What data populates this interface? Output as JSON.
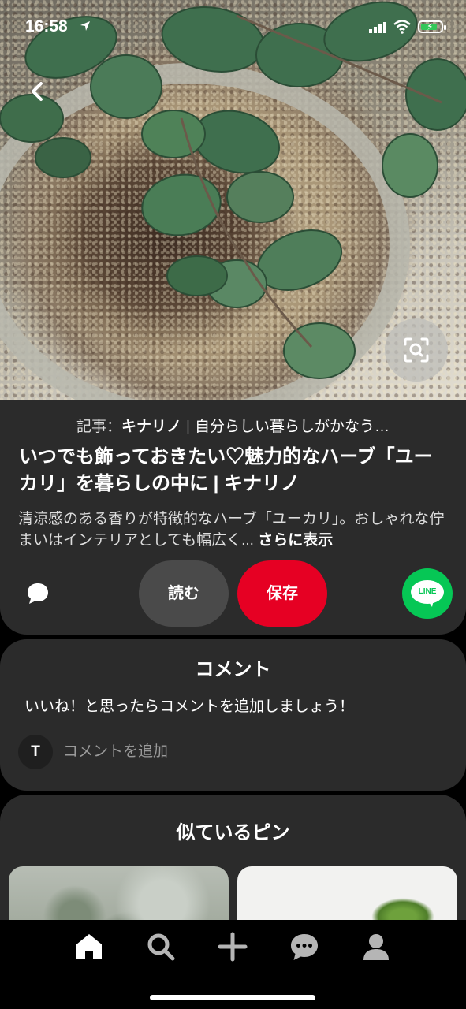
{
  "status_bar": {
    "time": "16:58"
  },
  "pin": {
    "source_prefix": "記事：",
    "source_brand": "キナリノ",
    "source_tagline": "自分らしい暮らしがかなう…",
    "title": "いつでも飾っておきたい♡魅力的なハーブ「ユーカリ」を暮らしの中に | キナリノ",
    "description": "清涼感のある香りが特徴的なハーブ「ユーカリ」。おしゃれな佇まいはインテリアとしても幅広く...",
    "more_label": "さらに表示",
    "read_label": "読む",
    "save_label": "保存",
    "line_label": "LINE"
  },
  "comments": {
    "heading": "コメント",
    "prompt": "いいね！と思ったらコメントを追加しましょう！",
    "avatar_initial": "T",
    "placeholder": "コメントを追加"
  },
  "similar": {
    "heading": "似ているピン"
  },
  "colors": {
    "save": "#e60023",
    "line": "#06c755",
    "card": "#2b2b2b"
  },
  "icons": [
    "back-chevron-icon",
    "visual-search-icon",
    "comment-bubble-icon",
    "line-icon",
    "home-icon",
    "search-icon",
    "plus-icon",
    "messages-icon",
    "profile-icon"
  ]
}
